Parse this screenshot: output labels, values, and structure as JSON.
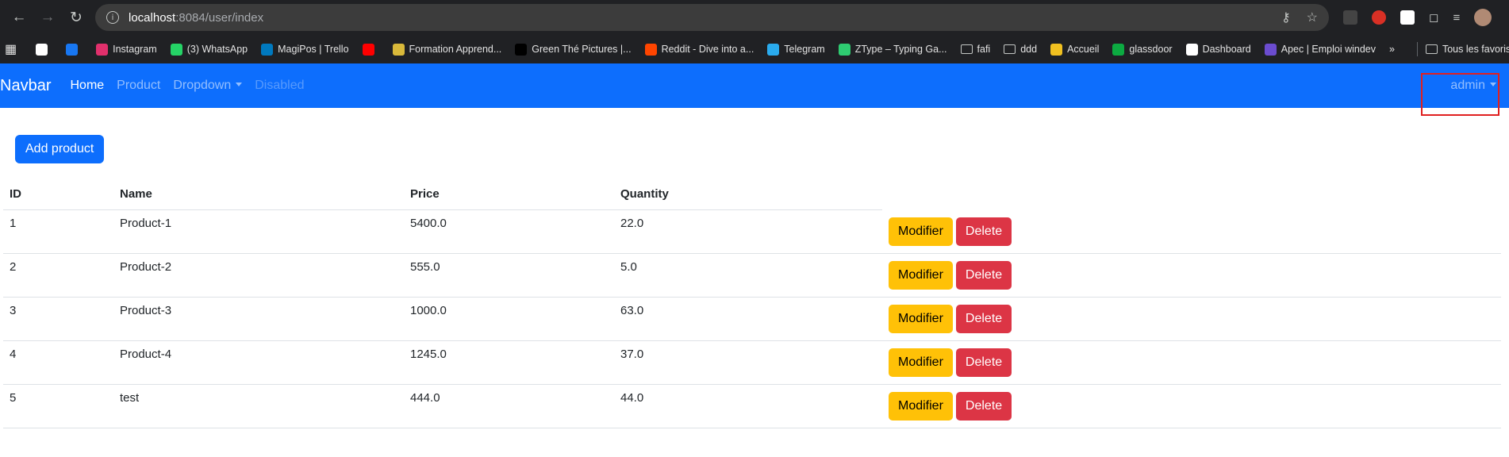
{
  "browser": {
    "url_host": "localhost",
    "url_rest": ":8084/user/index",
    "bookmarks": [
      {
        "label": "",
        "color": "#ffffff"
      },
      {
        "label": "",
        "color": "#1877f2"
      },
      {
        "label": "Instagram",
        "color": "#e1306c"
      },
      {
        "label": "(3) WhatsApp",
        "color": "#25d366"
      },
      {
        "label": "MagiPos | Trello",
        "color": "#0079bf"
      },
      {
        "label": "",
        "color": "#ff0000"
      },
      {
        "label": "Formation Apprend...",
        "color": "#d9b93a"
      },
      {
        "label": "Green Thé Pictures |...",
        "color": "#000000"
      },
      {
        "label": "Reddit - Dive into a...",
        "color": "#ff4500"
      },
      {
        "label": "Telegram",
        "color": "#2aabee"
      },
      {
        "label": "ZType – Typing Ga...",
        "color": "#2ecc71"
      },
      {
        "label": "fafi",
        "folder": true
      },
      {
        "label": "ddd",
        "folder": true
      },
      {
        "label": "Accueil",
        "color": "#f0c020"
      },
      {
        "label": "glassdoor",
        "color": "#0caa41"
      },
      {
        "label": "Dashboard",
        "color": "#ffffff"
      },
      {
        "label": "Apec | Emploi windev",
        "color": "#6b4ccf"
      }
    ],
    "all_bookmarks": "Tous les favoris"
  },
  "navbar": {
    "brand": "Navbar",
    "links": [
      "Home",
      "Product",
      "Dropdown",
      "Disabled"
    ],
    "user": "admin"
  },
  "page": {
    "add_label": "Add product",
    "columns": [
      "ID",
      "Name",
      "Price",
      "Quantity"
    ],
    "modify_label": "Modifier",
    "delete_label": "Delete",
    "rows": [
      {
        "id": "1",
        "name": "Product-1",
        "price": "5400.0",
        "qty": "22.0"
      },
      {
        "id": "2",
        "name": "Product-2",
        "price": "555.0",
        "qty": "5.0"
      },
      {
        "id": "3",
        "name": "Product-3",
        "price": "1000.0",
        "qty": "63.0"
      },
      {
        "id": "4",
        "name": "Product-4",
        "price": "1245.0",
        "qty": "37.0"
      },
      {
        "id": "5",
        "name": "test",
        "price": "444.0",
        "qty": "44.0"
      }
    ]
  },
  "colors": {
    "primary": "#0d6efd",
    "warning": "#ffc107",
    "danger": "#dc3545"
  }
}
